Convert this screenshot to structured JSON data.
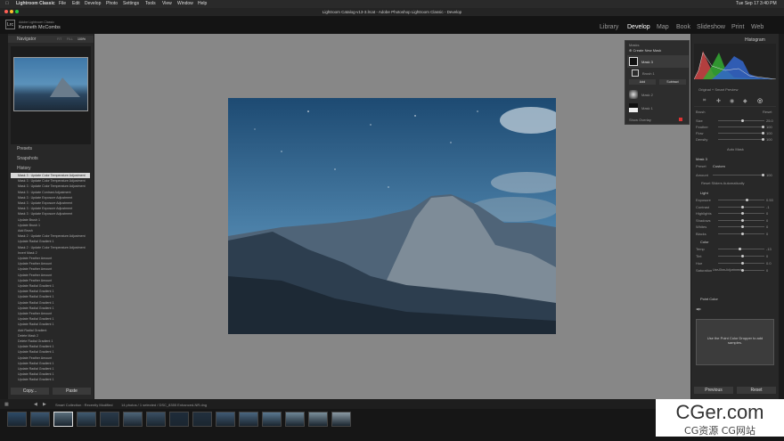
{
  "menubar": {
    "app": "Lightroom Classic",
    "items": [
      "File",
      "Edit",
      "Develop",
      "Photo",
      "Settings",
      "Tools",
      "View",
      "Window",
      "Help"
    ],
    "window_title": "Lightroom Catalog-v13-3.lrcat - Adobe Photoshop Lightroom Classic - Develop",
    "clock": "Tue Sep 17  3:40 PM"
  },
  "header": {
    "logo": "Lrc",
    "subtitle": "Adobe Lightroom Classic",
    "user": "Kenneth McCombs",
    "modules": [
      "Library",
      "Develop",
      "Map",
      "Book",
      "Slideshow",
      "Print",
      "Web"
    ],
    "active_module": "Develop"
  },
  "left_panel": {
    "navigator": {
      "title": "Navigator",
      "zoom_options": [
        "FIT",
        "FILL",
        "100%",
        "1:1"
      ]
    },
    "presets": "Presets",
    "snapshots": "Snapshots",
    "history": {
      "title": "History",
      "rows": [
        "Mask 3 : Update Color Temperature Adjustment",
        "Mask 3 : Update Color Temperature Adjustment",
        "Mask 3 : Update Color Temperature Adjustment",
        "Mask 3 : Update Contrast Adjustment",
        "Mask 3 : Update Exposure Adjustment",
        "Mask 3 : Update Exposure Adjustment",
        "Mask 3 : Update Exposure Adjustment",
        "Mask 3 : Update Exposure Adjustment",
        "Update Brush 1",
        "Update Brush 1",
        "Add Brush",
        "Mask 2 : Update Color Temperature Adjustment",
        "Update Radial Gradient 1",
        "Mask 2 : Update Color Temperature Adjustment",
        "Invert Mask 2",
        "Update Feather Amount",
        "Update Feather Amount",
        "Update Feather Amount",
        "Update Feather Amount",
        "Update Feather Amount",
        "Update Radial Gradient 1",
        "Update Radial Gradient 1",
        "Update Radial Gradient 1",
        "Update Radial Gradient 1",
        "Update Radial Gradient 1",
        "Update Feather Amount",
        "Update Radial Gradient 1",
        "Update Radial Gradient 1",
        "Add Radial Gradient",
        "Delete Mask 2",
        "Delete Radial Gradient 1",
        "Update Radial Gradient 1",
        "Update Radial Gradient 1",
        "Update Feather Amount",
        "Update Radial Gradient 1",
        "Update Radial Gradient 1",
        "Update Radial Gradient 1",
        "Update Radial Gradient 1"
      ]
    },
    "copy_label": "Copy...",
    "paste_label": "Paste"
  },
  "mask_panel": {
    "title": "Masks",
    "create_label": "Create New Mask",
    "masks": [
      "Mask 3",
      "Brush 1",
      "Mask 2",
      "Mask 1"
    ],
    "add_label": "Add",
    "subtract_label": "Subtract",
    "show_overlay": "Show Overlay"
  },
  "right_panel": {
    "histogram_title": "Histogram",
    "original_preview": "Original + Smart Preview",
    "brush_label": "Brush",
    "reset_label": "Reset",
    "brush_rows": [
      "Size",
      "Feather",
      "Flow",
      "Density"
    ],
    "brush_values": [
      "25.0",
      "100",
      "100",
      "100"
    ],
    "auto_mask": "Auto Mask",
    "mask_name": "Mask 3",
    "preset_label": "Preset",
    "preset_value": "Custom",
    "amount_label": "Amount",
    "amount_value": "100",
    "invert_label": "Reset Sliders Automatically",
    "light_title": "Light",
    "light_rows": [
      "Exposure",
      "Contrast",
      "Highlights",
      "Shadows",
      "Whites",
      "Blacks"
    ],
    "light_values": [
      "0.53",
      "-1",
      "0",
      "0",
      "0",
      "0"
    ],
    "color_title": "Color",
    "color_rows": [
      "Temp",
      "Tint",
      "Hue",
      "Saturation"
    ],
    "color_values": [
      "-13",
      "0",
      "0.0",
      "0"
    ],
    "use_fine": "Use Fine Adjustment",
    "point_color": "Point Color",
    "point_color_hint": "Use the Point Color Dropper to add samples.",
    "previous_label": "Previous",
    "reset_bottom": "Reset"
  },
  "filmstrip": {
    "collection": "Smart Collection : Recently Modified",
    "count": "14 photos / 1 selected / DSC_8355 Enhanced-NR.dng",
    "thumbs": 15
  },
  "watermark": {
    "line1": "CGer.com",
    "line2": "CG资源  CG网站"
  }
}
